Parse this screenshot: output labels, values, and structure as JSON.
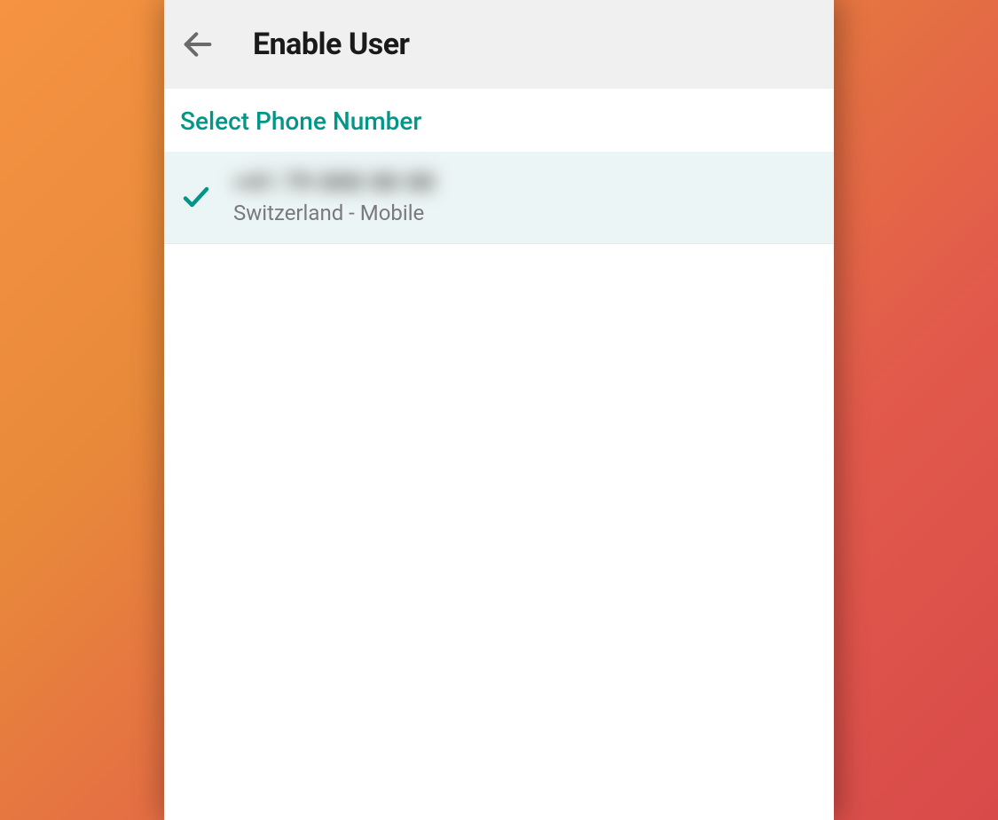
{
  "header": {
    "title": "Enable User"
  },
  "section": {
    "label": "Select Phone Number"
  },
  "phone_items": [
    {
      "number_masked": "+41 79 000 00 00",
      "type_label": "Switzerland - Mobile",
      "selected": true
    }
  ],
  "colors": {
    "accent": "#009688"
  }
}
